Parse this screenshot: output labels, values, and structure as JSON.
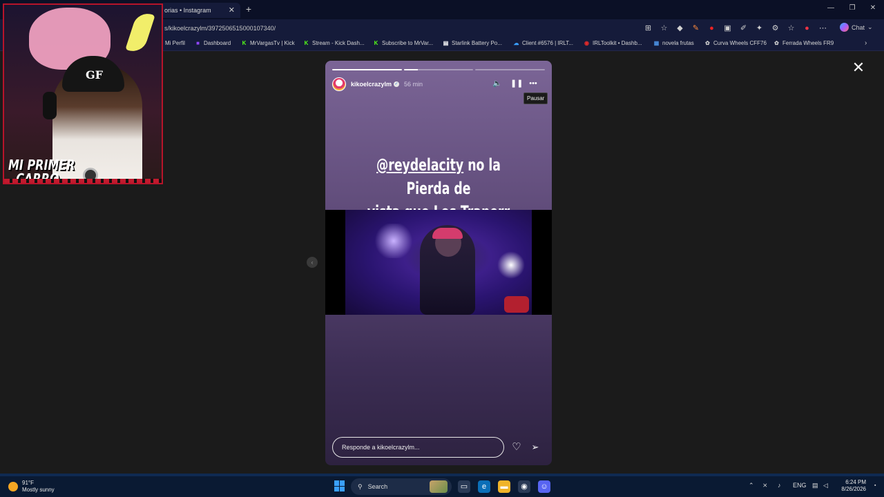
{
  "browser": {
    "tab_title": "orias • Instagram",
    "url": "s/kikoelcrazylm/3972506515000107340/",
    "chat_label": "Chat",
    "bookmarks": [
      {
        "label": "Mi Perfil",
        "icon": "instagram-icon",
        "color": "#d6d6d6"
      },
      {
        "label": "Dashboard",
        "icon": "twitch-icon",
        "color": "#9146ff"
      },
      {
        "label": "MrVargasTv | Kick",
        "icon": "kick-icon",
        "color": "#53fc18"
      },
      {
        "label": "Stream - Kick Dash...",
        "icon": "kick-icon",
        "color": "#53fc18"
      },
      {
        "label": "Subscribe to MrVar...",
        "icon": "kick-icon",
        "color": "#53fc18"
      },
      {
        "label": "Starlink Battery Po...",
        "icon": "page-icon",
        "color": "#ffffff"
      },
      {
        "label": "Client #6576 | IRLT...",
        "icon": "cloud-icon",
        "color": "#3aa0ff"
      },
      {
        "label": "IRLToolkit • Dashb...",
        "icon": "irltoolkit-icon",
        "color": "#e02a2a"
      },
      {
        "label": "novela frutas",
        "icon": "doc-icon",
        "color": "#4a90e2"
      },
      {
        "label": "Curva Wheels CFF76",
        "icon": "wheel-icon",
        "color": "#cfcfcf"
      },
      {
        "label": "Ferrada Wheels FR9",
        "icon": "wheel-icon",
        "color": "#cfcfcf"
      }
    ]
  },
  "story": {
    "username": "kikoelcrazylm",
    "time_ago": "56 min",
    "progress": [
      1.0,
      0.2,
      0.0
    ],
    "caption_mention": "@reydelacity",
    "caption_rest_line1": " no la Pierda de",
    "caption_line2": "vista que Los Traperr son duroo",
    "tooltip": "Pausar",
    "reply_placeholder": "Responde a kikoelcrazylm..."
  },
  "webcam": {
    "label_line1": "MI PRIMER",
    "label_line2": "CARRO"
  },
  "taskbar": {
    "temperature": "91°F",
    "weather": "Mostly sunny",
    "search_label": "Search",
    "language": "ENG",
    "time": "6:24 PM",
    "date": "8/26/2026"
  },
  "colors": {
    "browser_bg": "#0b1026",
    "story_top": "#7b6596",
    "story_bottom": "#2d2240",
    "webcam_border": "#b8142a"
  }
}
